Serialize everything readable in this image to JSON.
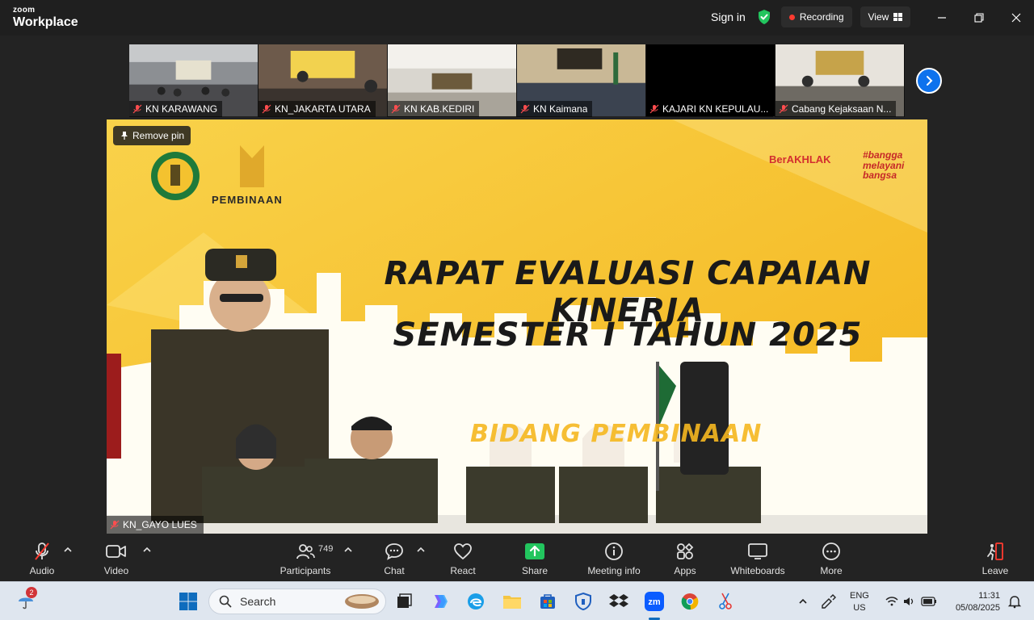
{
  "titlebar": {
    "brand_top": "zoom",
    "brand_bottom": "Workplace",
    "sign_in": "Sign in",
    "recording": "Recording",
    "view": "View"
  },
  "thumbnails": [
    {
      "name": "KN KARAWANG"
    },
    {
      "name": "KN_JAKARTA UTARA"
    },
    {
      "name": "KN KAB.KEDIRI"
    },
    {
      "name": "KN Kaimana"
    },
    {
      "name": "KAJARI KN KEPULAU..."
    },
    {
      "name": "Cabang Kejaksaan N..."
    }
  ],
  "stage": {
    "remove_pin": "Remove pin",
    "speaker_name": "KN_GAYO LUES",
    "headline_1": "RAPAT EVALUASI CAPAIAN KINERJA",
    "headline_2": "SEMESTER I TAHUN 2025",
    "bidang": "BIDANG PEMBINAAN",
    "logo_text": "PEMBINAAN",
    "berakhlak": "BerAKHLAK",
    "bangga": "#bangga melayani bangsa"
  },
  "toolbar": {
    "audio": "Audio",
    "video": "Video",
    "participants": "Participants",
    "participant_count": "749",
    "chat": "Chat",
    "react": "React",
    "share": "Share",
    "meeting_info": "Meeting info",
    "apps": "Apps",
    "whiteboards": "Whiteboards",
    "more": "More",
    "leave": "Leave"
  },
  "taskbar": {
    "search_placeholder": "Search",
    "notification_count": "2",
    "lang_1": "ENG",
    "lang_2": "US",
    "time": "11:31",
    "date": "05/08/2025"
  },
  "colors": {
    "accent_blue": "#0e72ed",
    "share_green": "#22c55e",
    "recording_red": "#ff3b30",
    "stage_yellow": "#f7c531"
  }
}
